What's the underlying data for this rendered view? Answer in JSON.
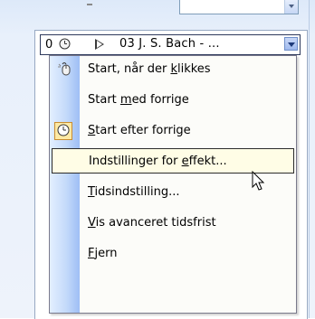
{
  "top_field": {
    "value": ""
  },
  "list_item": {
    "number": "0",
    "clock_icon": "clock-icon",
    "play_icon": "play-icon",
    "title": "03 J. S. Bach - ..."
  },
  "menu": {
    "items": [
      {
        "pre": "Start, når der ",
        "u": "k",
        "post": "likkes",
        "icon": "mouse-click-icon",
        "checked": false
      },
      {
        "pre": "Start ",
        "u": "m",
        "post": "ed forrige",
        "icon": "",
        "checked": false
      },
      {
        "pre": "",
        "u": "S",
        "post": "tart efter forrige",
        "icon": "clock-icon",
        "checked": true
      },
      {
        "pre": "Indstillinger for ",
        "u": "e",
        "post": "ffekt...",
        "icon": "",
        "checked": false
      },
      {
        "pre": "",
        "u": "T",
        "post": "idsindstilling...",
        "icon": "",
        "checked": false
      },
      {
        "pre": "",
        "u": "V",
        "post": "is avanceret tidsfrist",
        "icon": "",
        "checked": false
      },
      {
        "pre": "",
        "u": "F",
        "post": "jern",
        "icon": "",
        "checked": false
      }
    ]
  },
  "colors": {
    "menu_strip": "#c4dafa",
    "hover_border": "#2b2b2b",
    "checked_bg": "#fde9a4"
  }
}
